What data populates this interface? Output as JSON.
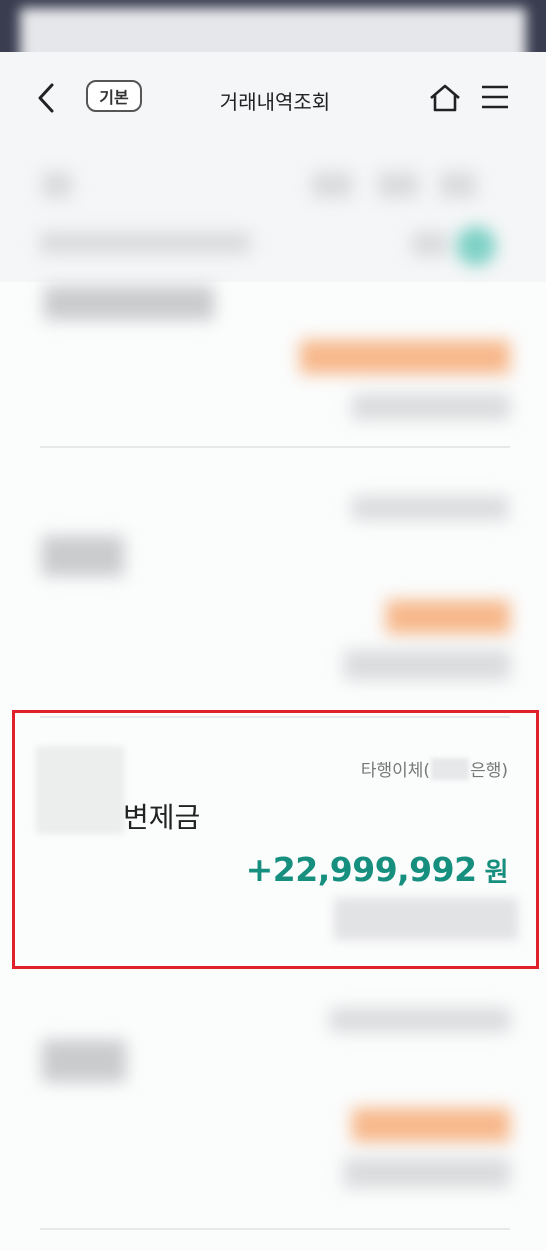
{
  "header": {
    "badge": "기본",
    "title": "거래내역조회"
  },
  "transaction": {
    "type_prefix": "타행이체(",
    "type_suffix": "은행)",
    "description": "변제금",
    "amount": "+22,999,992",
    "currency": "원"
  },
  "colors": {
    "accent": "#168f7f",
    "highlight_border": "#e0202b",
    "statusbar": "#3a3d50"
  }
}
